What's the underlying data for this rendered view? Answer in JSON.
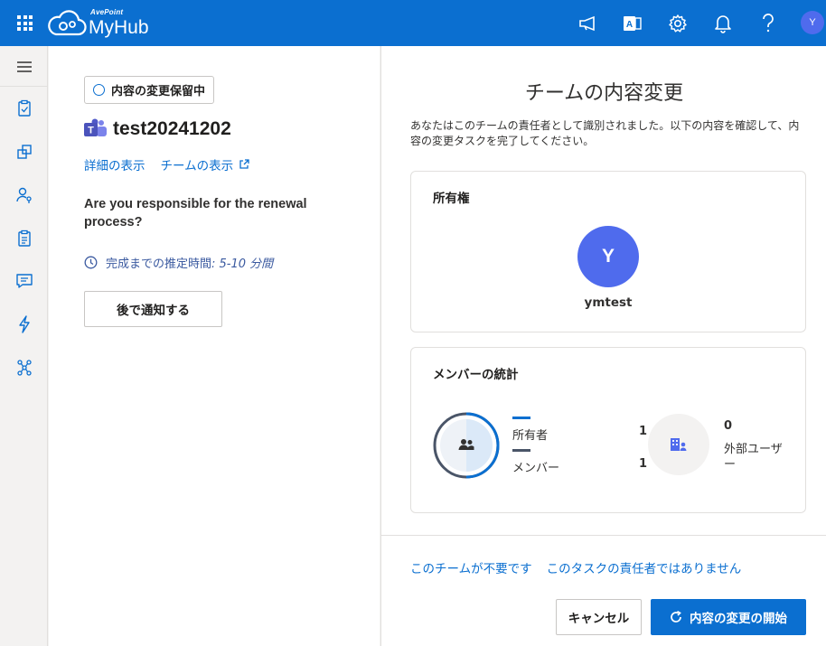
{
  "header": {
    "brand": "AvePoint",
    "product": "MyHub",
    "user_initial": "Y",
    "icons": [
      "waffle-icon",
      "megaphone-icon",
      "access-icon",
      "gear-icon",
      "bell-icon",
      "help-icon"
    ]
  },
  "rail": {
    "items": [
      "hamburger-icon",
      "clipboard-icon",
      "workspaces-icon",
      "user-key-icon",
      "checklist-icon",
      "chat-icon",
      "flash-icon",
      "network-icon"
    ]
  },
  "left": {
    "status": "内容の変更保留中",
    "team_name": "test20241202",
    "link_details": "詳細の表示",
    "link_team": "チームの表示",
    "question": "Are you responsible for the renewal process?",
    "estimate_label": "完成までの推定時間",
    "estimate_value": ": 5-10 分間",
    "notify_label": "後で通知する"
  },
  "right": {
    "title": "チームの内容変更",
    "description": "あなたはこのチームの責任者として識別されました。以下の内容を確認して、内容の変更タスクを完了してください。",
    "ownership": {
      "heading": "所有権",
      "owner_initial": "Y",
      "owner_name": "ymtest"
    },
    "members": {
      "heading": "メンバーの統計",
      "owners_label": "所有者",
      "owners_count": "1",
      "members_label": "メンバー",
      "members_count": "1",
      "external_count": "0",
      "external_label": "外部ユーザー"
    },
    "footer": {
      "not_needed": "このチームが不要です",
      "not_responsible": "このタスクの責任者ではありません",
      "cancel": "キャンセル",
      "start": "内容の変更の開始"
    }
  },
  "colors": {
    "accent": "#0b6fd0",
    "avatar": "#4f6bed",
    "members_ring": "#4a5568"
  }
}
